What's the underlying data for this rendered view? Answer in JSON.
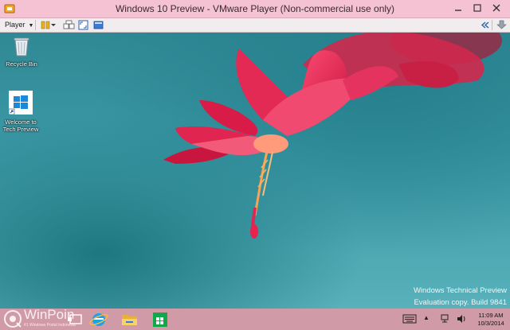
{
  "window": {
    "title": "Windows 10 Preview - VMware Player (Non-commercial use only)"
  },
  "toolbar": {
    "player_menu_label": "Player"
  },
  "desktop": {
    "icons": [
      {
        "label": "Recycle Bin",
        "icon": "recycle-bin-icon"
      },
      {
        "label": "Welcome to Tech Preview",
        "icon": "windows-logo-icon"
      }
    ],
    "watermark": {
      "line1": "Windows Technical Preview",
      "line2": "Evaluation copy. Build 9841"
    }
  },
  "taskbar": {
    "apps": [
      "search-icon",
      "task-view-icon",
      "internet-explorer-icon",
      "file-explorer-icon",
      "store-icon"
    ],
    "clock": {
      "time": "11:09 AM",
      "date": "10/3/2014"
    }
  },
  "brand": {
    "name": "WinPoin",
    "tagline": "#1 Windows Portal Indonesia"
  },
  "colors": {
    "titlebar": "#f4c2d2",
    "taskbar": "#d19aa7",
    "desktop": "#3c9aa6",
    "flower": "#e0244f"
  }
}
